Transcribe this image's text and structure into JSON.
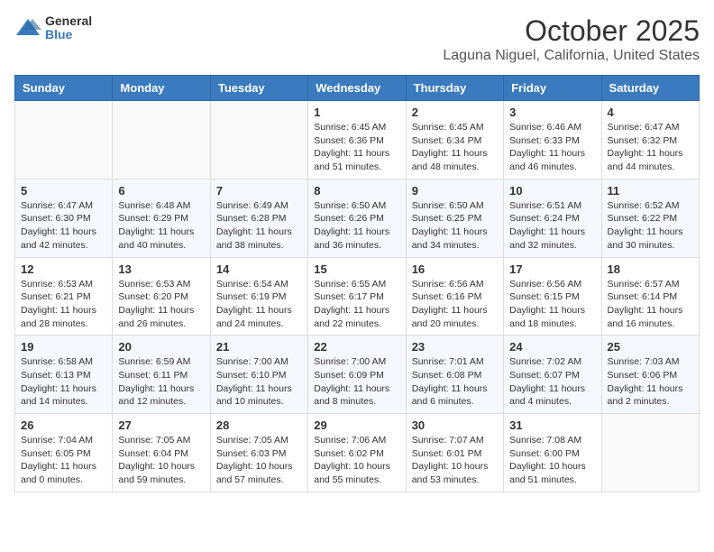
{
  "header": {
    "logo_general": "General",
    "logo_blue": "Blue",
    "month": "October 2025",
    "location": "Laguna Niguel, California, United States"
  },
  "days_of_week": [
    "Sunday",
    "Monday",
    "Tuesday",
    "Wednesday",
    "Thursday",
    "Friday",
    "Saturday"
  ],
  "weeks": [
    [
      {
        "day": "",
        "info": ""
      },
      {
        "day": "",
        "info": ""
      },
      {
        "day": "",
        "info": ""
      },
      {
        "day": "1",
        "info": "Sunrise: 6:45 AM\nSunset: 6:36 PM\nDaylight: 11 hours and 51 minutes."
      },
      {
        "day": "2",
        "info": "Sunrise: 6:45 AM\nSunset: 6:34 PM\nDaylight: 11 hours and 48 minutes."
      },
      {
        "day": "3",
        "info": "Sunrise: 6:46 AM\nSunset: 6:33 PM\nDaylight: 11 hours and 46 minutes."
      },
      {
        "day": "4",
        "info": "Sunrise: 6:47 AM\nSunset: 6:32 PM\nDaylight: 11 hours and 44 minutes."
      }
    ],
    [
      {
        "day": "5",
        "info": "Sunrise: 6:47 AM\nSunset: 6:30 PM\nDaylight: 11 hours and 42 minutes."
      },
      {
        "day": "6",
        "info": "Sunrise: 6:48 AM\nSunset: 6:29 PM\nDaylight: 11 hours and 40 minutes."
      },
      {
        "day": "7",
        "info": "Sunrise: 6:49 AM\nSunset: 6:28 PM\nDaylight: 11 hours and 38 minutes."
      },
      {
        "day": "8",
        "info": "Sunrise: 6:50 AM\nSunset: 6:26 PM\nDaylight: 11 hours and 36 minutes."
      },
      {
        "day": "9",
        "info": "Sunrise: 6:50 AM\nSunset: 6:25 PM\nDaylight: 11 hours and 34 minutes."
      },
      {
        "day": "10",
        "info": "Sunrise: 6:51 AM\nSunset: 6:24 PM\nDaylight: 11 hours and 32 minutes."
      },
      {
        "day": "11",
        "info": "Sunrise: 6:52 AM\nSunset: 6:22 PM\nDaylight: 11 hours and 30 minutes."
      }
    ],
    [
      {
        "day": "12",
        "info": "Sunrise: 6:53 AM\nSunset: 6:21 PM\nDaylight: 11 hours and 28 minutes."
      },
      {
        "day": "13",
        "info": "Sunrise: 6:53 AM\nSunset: 6:20 PM\nDaylight: 11 hours and 26 minutes."
      },
      {
        "day": "14",
        "info": "Sunrise: 6:54 AM\nSunset: 6:19 PM\nDaylight: 11 hours and 24 minutes."
      },
      {
        "day": "15",
        "info": "Sunrise: 6:55 AM\nSunset: 6:17 PM\nDaylight: 11 hours and 22 minutes."
      },
      {
        "day": "16",
        "info": "Sunrise: 6:56 AM\nSunset: 6:16 PM\nDaylight: 11 hours and 20 minutes."
      },
      {
        "day": "17",
        "info": "Sunrise: 6:56 AM\nSunset: 6:15 PM\nDaylight: 11 hours and 18 minutes."
      },
      {
        "day": "18",
        "info": "Sunrise: 6:57 AM\nSunset: 6:14 PM\nDaylight: 11 hours and 16 minutes."
      }
    ],
    [
      {
        "day": "19",
        "info": "Sunrise: 6:58 AM\nSunset: 6:13 PM\nDaylight: 11 hours and 14 minutes."
      },
      {
        "day": "20",
        "info": "Sunrise: 6:59 AM\nSunset: 6:11 PM\nDaylight: 11 hours and 12 minutes."
      },
      {
        "day": "21",
        "info": "Sunrise: 7:00 AM\nSunset: 6:10 PM\nDaylight: 11 hours and 10 minutes."
      },
      {
        "day": "22",
        "info": "Sunrise: 7:00 AM\nSunset: 6:09 PM\nDaylight: 11 hours and 8 minutes."
      },
      {
        "day": "23",
        "info": "Sunrise: 7:01 AM\nSunset: 6:08 PM\nDaylight: 11 hours and 6 minutes."
      },
      {
        "day": "24",
        "info": "Sunrise: 7:02 AM\nSunset: 6:07 PM\nDaylight: 11 hours and 4 minutes."
      },
      {
        "day": "25",
        "info": "Sunrise: 7:03 AM\nSunset: 6:06 PM\nDaylight: 11 hours and 2 minutes."
      }
    ],
    [
      {
        "day": "26",
        "info": "Sunrise: 7:04 AM\nSunset: 6:05 PM\nDaylight: 11 hours and 0 minutes."
      },
      {
        "day": "27",
        "info": "Sunrise: 7:05 AM\nSunset: 6:04 PM\nDaylight: 10 hours and 59 minutes."
      },
      {
        "day": "28",
        "info": "Sunrise: 7:05 AM\nSunset: 6:03 PM\nDaylight: 10 hours and 57 minutes."
      },
      {
        "day": "29",
        "info": "Sunrise: 7:06 AM\nSunset: 6:02 PM\nDaylight: 10 hours and 55 minutes."
      },
      {
        "day": "30",
        "info": "Sunrise: 7:07 AM\nSunset: 6:01 PM\nDaylight: 10 hours and 53 minutes."
      },
      {
        "day": "31",
        "info": "Sunrise: 7:08 AM\nSunset: 6:00 PM\nDaylight: 10 hours and 51 minutes."
      },
      {
        "day": "",
        "info": ""
      }
    ]
  ]
}
